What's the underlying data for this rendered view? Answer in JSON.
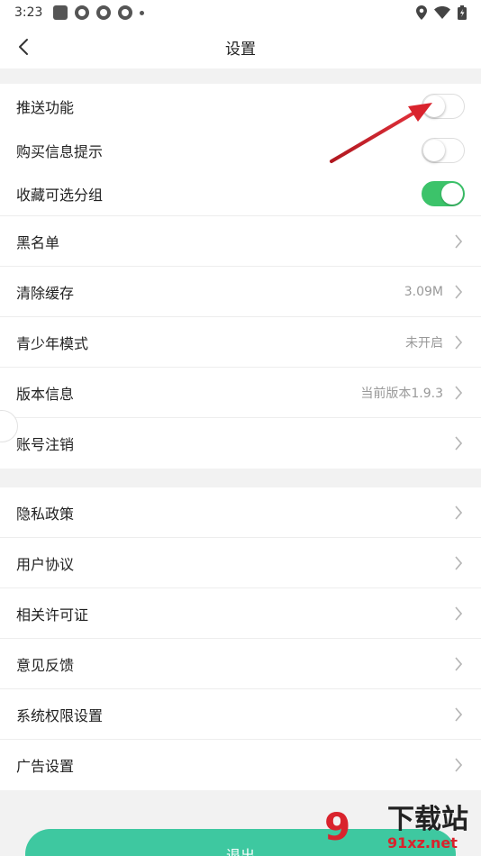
{
  "status_bar": {
    "time": "3:23"
  },
  "header": {
    "title": "设置"
  },
  "toggles": [
    {
      "label": "推送功能",
      "on": false
    },
    {
      "label": "购买信息提示",
      "on": false
    },
    {
      "label": "收藏可选分组",
      "on": true
    }
  ],
  "settings_group1": [
    {
      "label": "黑名单",
      "value": ""
    },
    {
      "label": "清除缓存",
      "value": "3.09M"
    },
    {
      "label": "青少年模式",
      "value": "未开启"
    },
    {
      "label": "版本信息",
      "value": "当前版本1.9.3"
    },
    {
      "label": "账号注销",
      "value": ""
    }
  ],
  "settings_group2": [
    {
      "label": "隐私政策"
    },
    {
      "label": "用户协议"
    },
    {
      "label": "相关许可证"
    },
    {
      "label": "意见反馈"
    },
    {
      "label": "系统权限设置"
    },
    {
      "label": "广告设置"
    }
  ],
  "logout": {
    "label": "退出"
  },
  "watermark": {
    "logo": "9",
    "title": "下载站",
    "url": "91xz.net"
  },
  "colors": {
    "accent_green": "#3cc36a",
    "logout_teal": "#3ec8a0",
    "annotation_red": "#d9232d"
  }
}
